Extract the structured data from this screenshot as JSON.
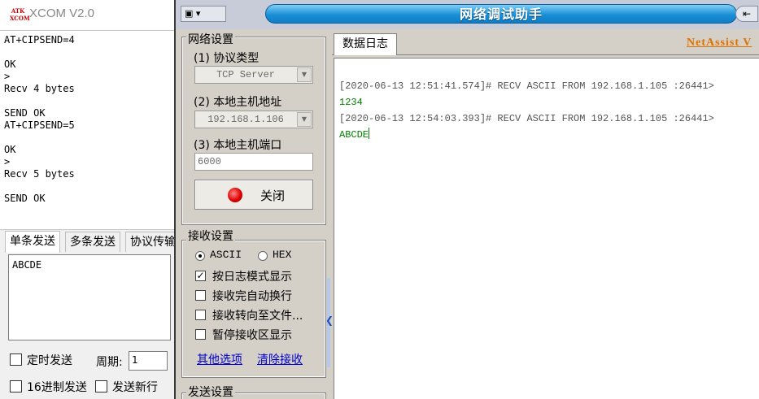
{
  "xcom": {
    "logo_text": "ATK XCOM",
    "title": "XCOM V2.0",
    "receive_lines": [
      "AT+CIPSEND=4",
      "",
      "OK",
      ">",
      "Recv 4 bytes",
      "",
      "SEND OK",
      "AT+CIPSEND=5",
      "",
      "OK",
      ">",
      "Recv 5 bytes",
      "",
      "SEND OK"
    ],
    "tabs": [
      "单条发送",
      "多条发送",
      "协议传输"
    ],
    "send_text": "ABCDE",
    "timed_send_label": "定时发送",
    "period_label": "周期:",
    "period_value": "1",
    "hex_send_label": "16进制发送",
    "newline_label": "发送新行"
  },
  "netassist": {
    "sysmenu_label": "▾",
    "title": "网络调试助手",
    "pin_label": "⇤",
    "network_group_title": "网络设置",
    "protocol_label": "(1) 协议类型",
    "protocol_value": "TCP Server",
    "local_addr_label": "(2) 本地主机地址",
    "local_addr_value": "192.168.1.106",
    "local_port_label": "(3) 本地主机端口",
    "local_port_value": "6000",
    "close_button_label": "关闭",
    "recv_group_title": "接收设置",
    "ascii_label": "ASCII",
    "hex_label": "HEX",
    "log_mode_label": "按日志模式显示",
    "auto_wrap_label": "接收完自动换行",
    "to_file_label": "接收转向至文件...",
    "pause_label": "暂停接收区显示",
    "more_options_label": "其他选项",
    "clear_recv_label": "清除接收",
    "send_group_title": "发送设置",
    "log_tab_label": "数据日志",
    "brand_label": "NetAssist V",
    "log_entries": [
      {
        "header": "[2020-06-13 12:51:41.574]# RECV ASCII FROM 192.168.1.105 :26441>",
        "data": "1234"
      },
      {
        "header": "[2020-06-13 12:54:03.393]# RECV ASCII FROM 192.168.1.105 :26441>",
        "data": "ABCDE"
      }
    ]
  },
  "colors": {
    "title_bar_blue": "#1a8fd6",
    "log_data_green": "#008000",
    "brand_orange": "#e07000",
    "link_blue": "#0000cc",
    "led_red": "#e00000"
  }
}
